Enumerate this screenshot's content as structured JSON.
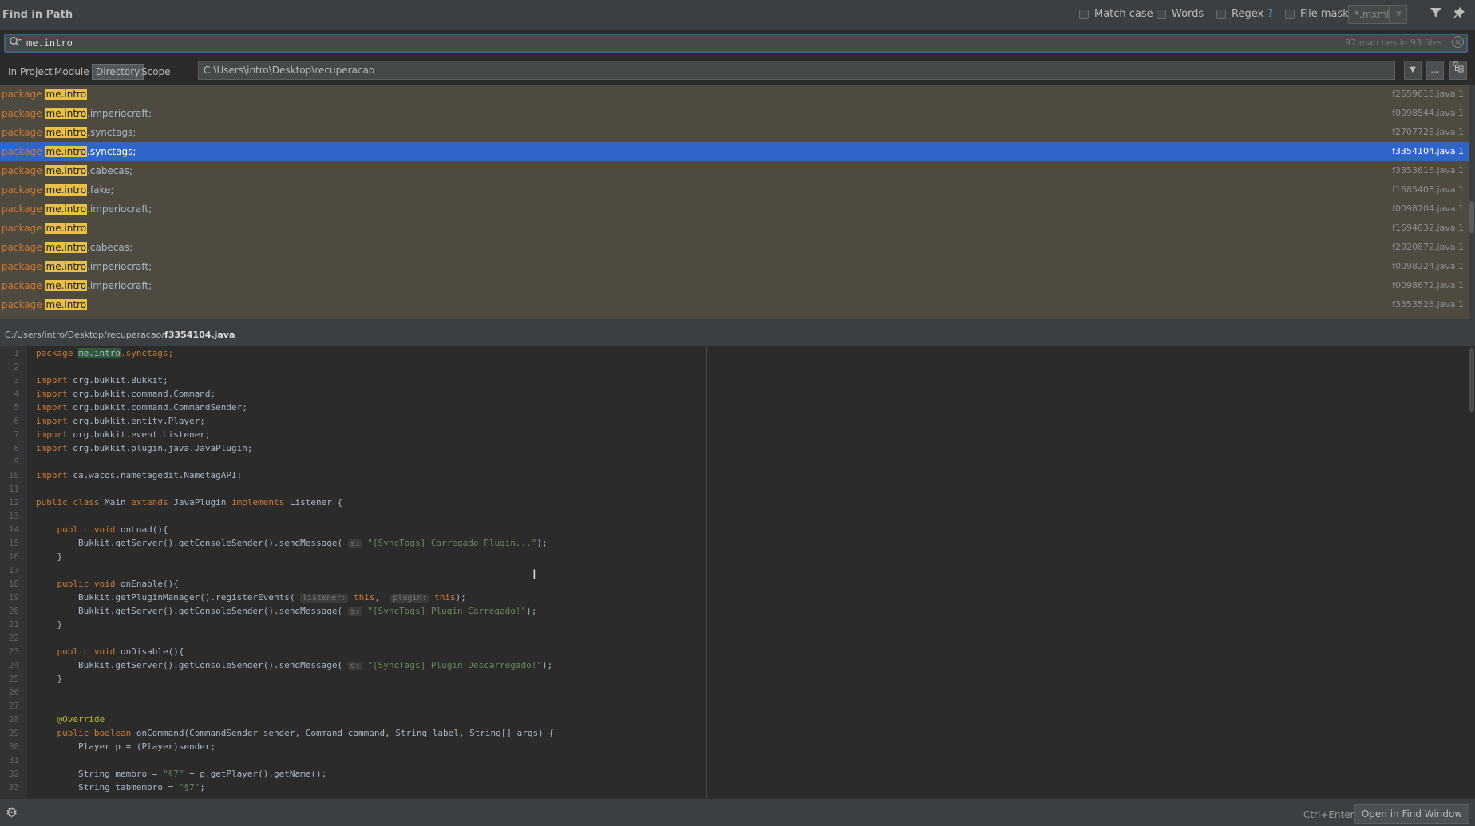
{
  "header": {
    "title": "Find in Path",
    "options": {
      "match_case": "Match case",
      "words": "Words",
      "regex": "Regex",
      "regex_help": "?",
      "file_mask": "File mask:",
      "file_mask_value": "*.mxml"
    },
    "icons": [
      "filter-icon",
      "pin-icon"
    ]
  },
  "search": {
    "query": "me.intro",
    "match_count": "97 matches in 93 files"
  },
  "scope": {
    "tabs": [
      "In Project",
      "Module",
      "Directory",
      "Scope"
    ],
    "active_tab": "Directory",
    "directory": "C:\\Users\\intro\\Desktop\\recuperacao",
    "browse_label": "..."
  },
  "results": [
    {
      "prefix": "package",
      "match": "me.intro",
      "rest": "",
      "file": "f2659616.java 1"
    },
    {
      "prefix": "package",
      "match": "me.intro",
      "rest": ".imperiocraft;",
      "file": "f0098544.java 1"
    },
    {
      "prefix": "package",
      "match": "me.intro",
      "rest": ".synctags;",
      "file": "f2707728.java 1"
    },
    {
      "prefix": "package",
      "match": "me.intro",
      "rest": ".synctags;",
      "file": "f3354104.java 1",
      "selected": true
    },
    {
      "prefix": "package",
      "match": "me.intro",
      "rest": ".cabecas;",
      "file": "f3353616.java 1"
    },
    {
      "prefix": "package",
      "match": "me.intro",
      "rest": ".fake;",
      "file": "f1685408.java 1"
    },
    {
      "prefix": "package",
      "match": "me.intro",
      "rest": ".imperiocraft;",
      "file": "f0098704.java 1"
    },
    {
      "prefix": "package",
      "match": "me.intro",
      "rest": "",
      "file": "f1694032.java 1"
    },
    {
      "prefix": "package",
      "match": "me.intro",
      "rest": ".cabecas;",
      "file": "f2920872.java 1"
    },
    {
      "prefix": "package",
      "match": "me.intro",
      "rest": ".imperiocraft;",
      "file": "f0098224.java 1"
    },
    {
      "prefix": "package",
      "match": "me.intro",
      "rest": ".imperiocraft;",
      "file": "f0098672.java 1"
    },
    {
      "prefix": "package",
      "match": "me.intro",
      "rest": "",
      "file": "f3353528.java 1"
    }
  ],
  "preview": {
    "path_prefix": "C:/Users/intro/Desktop/recuperacao/",
    "file_name": "f3354104.java",
    "lines": [
      [
        {
          "t": "package ",
          "c": "kw"
        },
        {
          "t": "me.intro",
          "c": "match"
        },
        {
          "t": ".synctags;",
          "c": "kw"
        }
      ],
      [],
      [
        {
          "t": "import ",
          "c": "kw"
        },
        {
          "t": "org.bukkit.Bukkit;",
          "c": ""
        }
      ],
      [
        {
          "t": "import ",
          "c": "kw"
        },
        {
          "t": "org.bukkit.command.Command;",
          "c": ""
        }
      ],
      [
        {
          "t": "import ",
          "c": "kw"
        },
        {
          "t": "org.bukkit.command.CommandSender;",
          "c": ""
        }
      ],
      [
        {
          "t": "import ",
          "c": "kw"
        },
        {
          "t": "org.bukkit.entity.Player;",
          "c": ""
        }
      ],
      [
        {
          "t": "import ",
          "c": "kw"
        },
        {
          "t": "org.bukkit.event.Listener;",
          "c": ""
        }
      ],
      [
        {
          "t": "import ",
          "c": "kw"
        },
        {
          "t": "org.bukkit.plugin.java.JavaPlugin;",
          "c": ""
        }
      ],
      [],
      [
        {
          "t": "import ",
          "c": "kw"
        },
        {
          "t": "ca.wacos.nametagedit.NametagAPI;",
          "c": ""
        }
      ],
      [],
      [
        {
          "t": "public class ",
          "c": "kw"
        },
        {
          "t": "Main ",
          "c": ""
        },
        {
          "t": "extends ",
          "c": "kw"
        },
        {
          "t": "JavaPlugin ",
          "c": ""
        },
        {
          "t": "implements ",
          "c": "kw"
        },
        {
          "t": "Listener {",
          "c": ""
        }
      ],
      [],
      [
        {
          "t": "    public void ",
          "c": "kw"
        },
        {
          "t": "onLoad(){",
          "c": ""
        }
      ],
      [
        {
          "t": "        Bukkit.getServer().getConsoleSender().sendMessage( ",
          "c": ""
        },
        {
          "t": "s:",
          "c": "hint"
        },
        {
          "t": " \"[SyncTags] Carregado Plugin...\"",
          "c": "str"
        },
        {
          "t": ");",
          "c": ""
        }
      ],
      [
        {
          "t": "    }",
          "c": ""
        }
      ],
      [],
      [
        {
          "t": "    public void ",
          "c": "kw"
        },
        {
          "t": "onEnable(){",
          "c": ""
        }
      ],
      [
        {
          "t": "        Bukkit.getPluginManager().registerEvents( ",
          "c": ""
        },
        {
          "t": "listener:",
          "c": "hint"
        },
        {
          "t": " this",
          "c": "kw"
        },
        {
          "t": ",  ",
          "c": ""
        },
        {
          "t": "plugin:",
          "c": "hint"
        },
        {
          "t": " this",
          "c": "kw"
        },
        {
          "t": ");",
          "c": ""
        }
      ],
      [
        {
          "t": "        Bukkit.getServer().getConsoleSender().sendMessage( ",
          "c": ""
        },
        {
          "t": "s:",
          "c": "hint"
        },
        {
          "t": " \"[SyncTags] Plugin Carregado!\"",
          "c": "str"
        },
        {
          "t": ");",
          "c": ""
        }
      ],
      [
        {
          "t": "    }",
          "c": ""
        }
      ],
      [],
      [
        {
          "t": "    public void ",
          "c": "kw"
        },
        {
          "t": "onDisable(){",
          "c": ""
        }
      ],
      [
        {
          "t": "        Bukkit.getServer().getConsoleSender().sendMessage( ",
          "c": ""
        },
        {
          "t": "s:",
          "c": "hint"
        },
        {
          "t": " \"[SyncTags] Plugin Descarregado!\"",
          "c": "str"
        },
        {
          "t": ");",
          "c": ""
        }
      ],
      [
        {
          "t": "    }",
          "c": ""
        }
      ],
      [],
      [],
      [
        {
          "t": "    @Override",
          "c": "ann"
        }
      ],
      [
        {
          "t": "    public boolean ",
          "c": "kw"
        },
        {
          "t": "onCommand(CommandSender sender, Command command, String label, String[] args) {",
          "c": ""
        }
      ],
      [
        {
          "t": "        Player p = (Player)sender;",
          "c": ""
        }
      ],
      [],
      [
        {
          "t": "        String membro = ",
          "c": ""
        },
        {
          "t": "\"§7\"",
          "c": "str"
        },
        {
          "t": " + p.getPlayer().getName();",
          "c": ""
        }
      ],
      [
        {
          "t": "        String tabmembro = ",
          "c": ""
        },
        {
          "t": "\"§7\"",
          "c": "str"
        },
        {
          "t": ";",
          "c": ""
        }
      ]
    ]
  },
  "footer": {
    "shortcut": "Ctrl+Enter",
    "open_button": "Open in Find Window"
  }
}
